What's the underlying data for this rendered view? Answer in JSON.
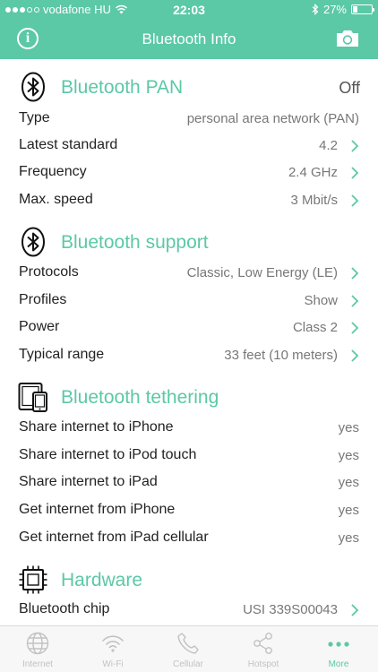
{
  "status_bar": {
    "carrier": "vodafone HU",
    "time": "22:03",
    "battery": "27%",
    "battery_level": 0.27
  },
  "nav": {
    "title": "Bluetooth Info",
    "info_icon": "info-circle-icon",
    "camera_icon": "camera-icon"
  },
  "sections": {
    "pan": {
      "title": "Bluetooth PAN",
      "value": "Off",
      "icon": "bluetooth-icon",
      "rows": [
        {
          "label": "Type",
          "value": "personal area network (PAN)"
        },
        {
          "label": "Latest standard",
          "value": "4.2"
        },
        {
          "label": "Frequency",
          "value": "2.4 GHz"
        },
        {
          "label": "Max. speed",
          "value": "3 Mbit/s"
        }
      ]
    },
    "support": {
      "title": "Bluetooth support",
      "icon": "bluetooth-icon",
      "rows": [
        {
          "label": "Protocols",
          "value": "Classic, Low Energy (LE)"
        },
        {
          "label": "Profiles",
          "value": "Show"
        },
        {
          "label": "Power",
          "value": "Class 2"
        },
        {
          "label": "Typical range",
          "value": "33 feet (10 meters)"
        }
      ]
    },
    "tethering": {
      "title": "Bluetooth tethering",
      "icon": "devices-icon",
      "rows": [
        {
          "label": "Share internet to iPhone",
          "value": "yes"
        },
        {
          "label": "Share internet to iPod touch",
          "value": "yes"
        },
        {
          "label": "Share internet to iPad",
          "value": "yes"
        },
        {
          "label": "Get internet from iPhone",
          "value": "yes"
        },
        {
          "label": "Get internet from iPad cellular",
          "value": "yes"
        }
      ]
    },
    "hardware": {
      "title": "Hardware",
      "icon": "chip-icon",
      "rows": [
        {
          "label": "Bluetooth chip",
          "value": "USI 339S00043"
        }
      ]
    }
  },
  "tabs": [
    {
      "label": "Internet",
      "icon": "globe-icon"
    },
    {
      "label": "Wi-Fi",
      "icon": "wifi-icon"
    },
    {
      "label": "Cellular",
      "icon": "phone-icon"
    },
    {
      "label": "Hotspot",
      "icon": "share-icon"
    },
    {
      "label": "More",
      "icon": "more-dots-icon"
    }
  ],
  "colors": {
    "accent": "#5bc8a6",
    "tab_inactive": "#c2c2c2"
  }
}
